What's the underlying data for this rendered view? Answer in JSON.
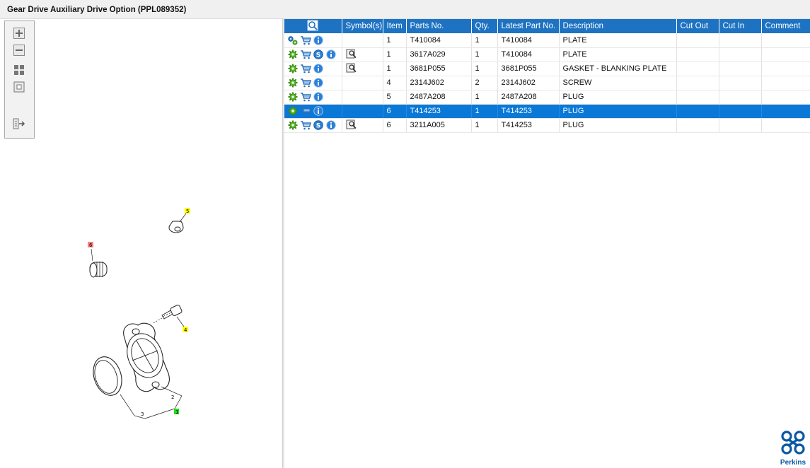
{
  "window": {
    "title": "Gear Drive Auxiliary Drive Option (PPL089352)"
  },
  "toolbar": {
    "zoom_in": "zoom-in-icon",
    "zoom_out": "zoom-out-icon",
    "fit_all": "fit-all-icon",
    "fit_page": "fit-page-icon",
    "export": "export-icon"
  },
  "drawing": {
    "callouts": [
      "5",
      "6",
      "4",
      "2",
      "3",
      "1"
    ],
    "colors": {
      "yellow": "#ffff00",
      "red": "#ff8080",
      "green": "#22dd22"
    }
  },
  "table": {
    "columns": [
      "",
      "Symbol(s)",
      "Item",
      "Parts No.",
      "Qty.",
      "Latest Part No.",
      "Description",
      "Cut Out",
      "Cut In",
      "Comment"
    ],
    "rows": [
      {
        "item": "1",
        "parts_no": "T410084",
        "qty": "1",
        "latest": "T410084",
        "description": "PLATE",
        "cut_out": "",
        "cut_in": "",
        "comment": ""
      },
      {
        "item": "1",
        "parts_no": "3617A029",
        "qty": "1",
        "latest": "T410084",
        "description": "PLATE",
        "cut_out": "",
        "cut_in": "",
        "comment": ""
      },
      {
        "item": "1",
        "parts_no": "3681P055",
        "qty": "1",
        "latest": "3681P055",
        "description": "GASKET - BLANKING PLATE",
        "cut_out": "",
        "cut_in": "",
        "comment": ""
      },
      {
        "item": "4",
        "parts_no": "2314J602",
        "qty": "2",
        "latest": "2314J602",
        "description": "SCREW",
        "cut_out": "",
        "cut_in": "",
        "comment": ""
      },
      {
        "item": "5",
        "parts_no": "2487A208",
        "qty": "1",
        "latest": "2487A208",
        "description": "PLUG",
        "cut_out": "",
        "cut_in": "",
        "comment": ""
      },
      {
        "item": "6",
        "parts_no": "T414253",
        "qty": "1",
        "latest": "T414253",
        "description": "PLUG",
        "cut_out": "",
        "cut_in": "",
        "comment": ""
      },
      {
        "item": "6",
        "parts_no": "3211A005",
        "qty": "1",
        "latest": "T414253",
        "description": "PLUG",
        "cut_out": "",
        "cut_in": "",
        "comment": ""
      }
    ],
    "selected_row": 5,
    "accent": "#1d73c2",
    "selection": "#0a78d7"
  },
  "brand": {
    "name": "Perkins",
    "color": "#0b59a6"
  }
}
